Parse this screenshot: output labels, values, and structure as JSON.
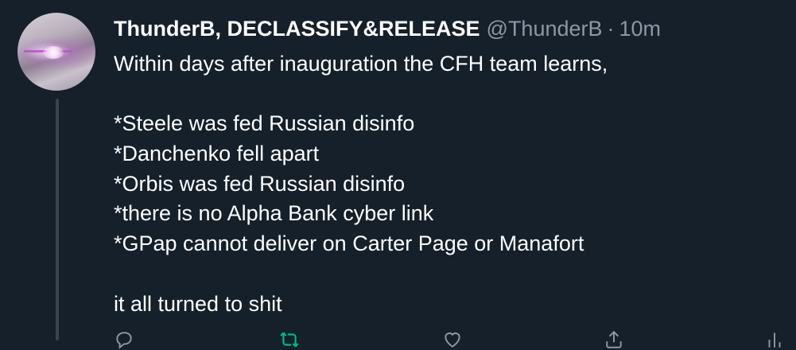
{
  "tweet": {
    "author": {
      "display_name": "ThunderB, DECLASSIFY&RELEASE",
      "handle": "@ThunderB",
      "separator": "·",
      "time": "10m"
    },
    "body_lines": [
      "Within days after inauguration the CFH team learns,",
      "",
      "*Steele was fed Russian disinfo",
      "*Danchenko fell apart",
      "*Orbis was fed Russian disinfo",
      "*there is no Alpha Bank cyber link",
      "*GPap cannot deliver on Carter Page or Manafort",
      "",
      "it all turned to shit"
    ],
    "actions": [
      {
        "icon": "reply-icon",
        "color": "#8b98a5"
      },
      {
        "icon": "retweet-icon",
        "color": "#00ba7c"
      },
      {
        "icon": "like-icon",
        "color": "#8b98a5"
      },
      {
        "icon": "share-icon",
        "color": "#8b98a5"
      }
    ]
  },
  "colors": {
    "background": "#15202b",
    "text": "#ffffff",
    "muted": "#8b98a5",
    "thread_line": "#38444d",
    "retweet_active": "#00ba7c"
  }
}
